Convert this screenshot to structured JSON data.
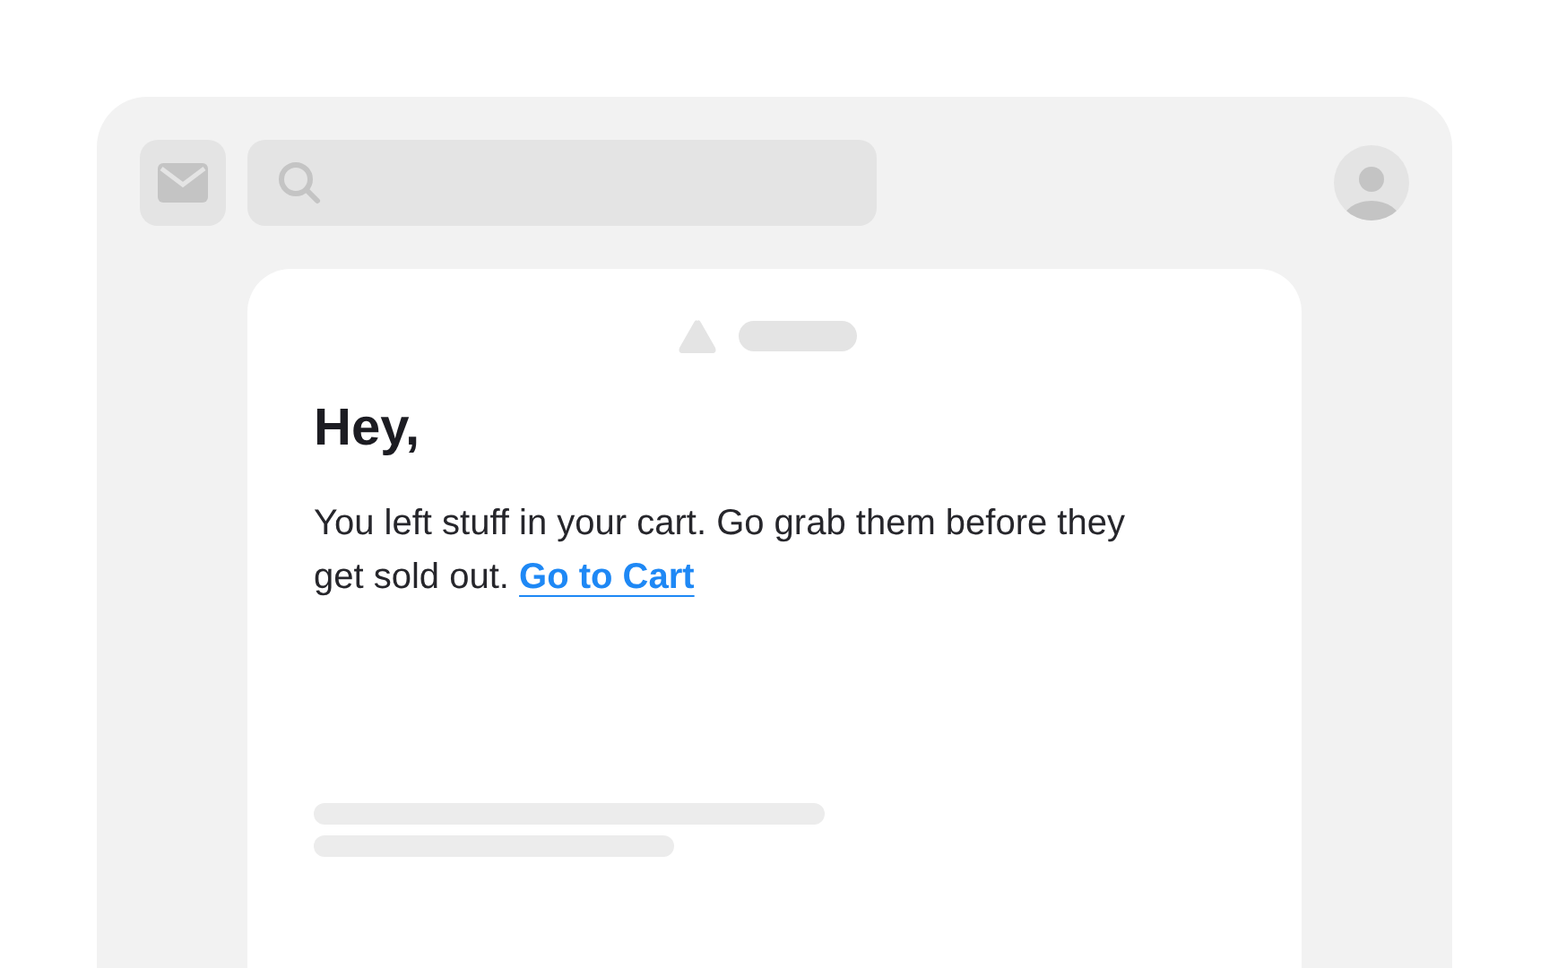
{
  "email": {
    "greeting": "Hey,",
    "message": "You left stuff in your cart. Go grab them before they get sold out.",
    "link": "Go to Cart"
  }
}
